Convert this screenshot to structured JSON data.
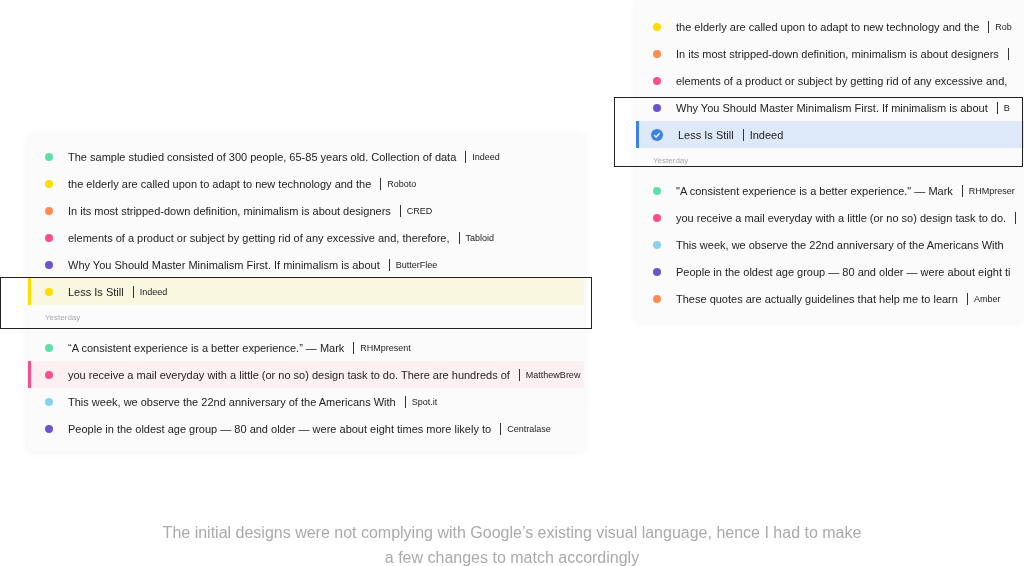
{
  "panels": [
    {
      "kind": "tinted",
      "sections": [
        {
          "items": [
            {
              "text": "The sample studied consisted of 300 people, 65-85 years old. Collection of data",
              "source": "Indeed",
              "color": "#5fe0a6",
              "selected": false,
              "hovered": false
            },
            {
              "text": "the elderly are called upon to adapt to new technology and the",
              "source": "Roboto",
              "color": "#fedc00",
              "selected": false,
              "hovered": false
            },
            {
              "text": "In its most stripped-down definition, minimalism is about designers",
              "source": "CRED",
              "color": "#fb8c4f",
              "selected": false,
              "hovered": false
            },
            {
              "text": "elements of a product or subject by getting rid of any excessive and, therefore,",
              "source": "Tabloid",
              "color": "#fb4f8a",
              "selected": false,
              "hovered": false
            },
            {
              "text": "Why You Should Master Minimalism First. If minimalism is about",
              "source": "ButterFlee",
              "color": "#6a55d0",
              "selected": false,
              "hovered": false
            },
            {
              "text": "Less Is Still",
              "source": "Indeed",
              "color": "#fedc00",
              "selected": true,
              "hovered": false
            }
          ]
        },
        {
          "heading": "Yesterday",
          "items": [
            {
              "text": "“A consistent experience is a better experience.” — Mark",
              "source": "RHMpresent",
              "color": "#5fe0a6",
              "selected": false,
              "hovered": false
            },
            {
              "text": "you receive a mail everyday with a little (or no so) design task to do. There are hundreds of",
              "source": "MatthewBrew",
              "color": "#fb4f8a",
              "selected": false,
              "hovered": true
            },
            {
              "text": "This week, we observe the 22nd anniversary of the Americans With",
              "source": "Spot.it",
              "color": "#86d1f0",
              "selected": false,
              "hovered": false
            },
            {
              "text": "People in the oldest age group — 80 and older — were about eight times more likely to",
              "source": "Centralase",
              "color": "#6a55d0",
              "selected": false,
              "hovered": false
            }
          ]
        }
      ]
    },
    {
      "kind": "checked",
      "sections": [
        {
          "items": [
            {
              "text": "the elderly are called upon to adapt to new technology and the",
              "source": "Rob",
              "color": "#fedc00",
              "selected": false,
              "hovered": false
            },
            {
              "text": "In its most stripped-down definition, minimalism is about designers",
              "separator": true,
              "color": "#fb8c4f",
              "selected": false,
              "hovered": false
            },
            {
              "text": "elements of a product or subject by getting rid of any excessive and,",
              "color": "#fb4f8a",
              "selected": false,
              "hovered": false
            },
            {
              "text": "Why You Should Master Minimalism First. If minimalism is about",
              "source": "B",
              "color": "#6a55d0",
              "selected": false,
              "hovered": false
            },
            {
              "text": "Less Is Still",
              "source": "Indeed",
              "color": "#3b82e8",
              "selected": true,
              "hovered": false
            }
          ]
        },
        {
          "heading": "Yesterday",
          "items": [
            {
              "text": "\"A consistent experience is a better experience.\" — Mark",
              "source": "RHMpreser",
              "color": "#5fe0a6",
              "selected": false,
              "hovered": false
            },
            {
              "text": "you receive a mail everyday with a little (or no so) design task to do.",
              "separator": true,
              "color": "#fb4f8a",
              "selected": false,
              "hovered": false
            },
            {
              "text": "This week, we observe the 22nd anniversary of the Americans With",
              "color": "#86d1f0",
              "selected": false,
              "hovered": false
            },
            {
              "text": "People in the oldest age group — 80 and older — were about eight ti",
              "color": "#6a55d0",
              "selected": false,
              "hovered": false
            },
            {
              "text": "These quotes are actually guidelines that help me to learn",
              "source": "Amber",
              "color": "#fb8c4f",
              "selected": false,
              "hovered": false
            }
          ]
        }
      ]
    }
  ],
  "caption": "The initial designs were not complying with Google’s existing visual language, hence I had to make a few changes to match accordingly"
}
